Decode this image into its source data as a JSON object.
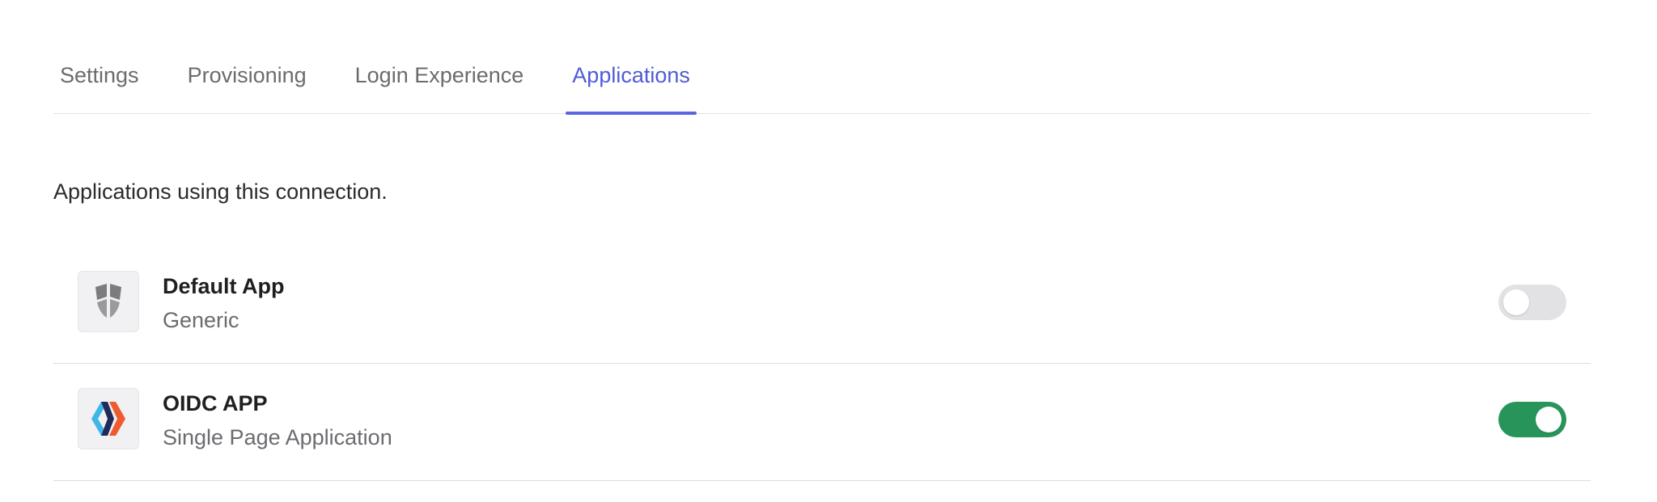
{
  "tabs": [
    {
      "label": "Settings",
      "active": false
    },
    {
      "label": "Provisioning",
      "active": false
    },
    {
      "label": "Login Experience",
      "active": false
    },
    {
      "label": "Applications",
      "active": true
    }
  ],
  "description": "Applications using this connection.",
  "applications": [
    {
      "name": "Default App",
      "type": "Generic",
      "icon": "shield-logo-icon",
      "enabled": false
    },
    {
      "name": "OIDC APP",
      "type": "Single Page Application",
      "icon": "spa-logo-icon",
      "enabled": true
    }
  ],
  "colors": {
    "accent": "#4f5bd5",
    "toggle_on": "#27955a",
    "toggle_off": "#e2e2e5"
  }
}
